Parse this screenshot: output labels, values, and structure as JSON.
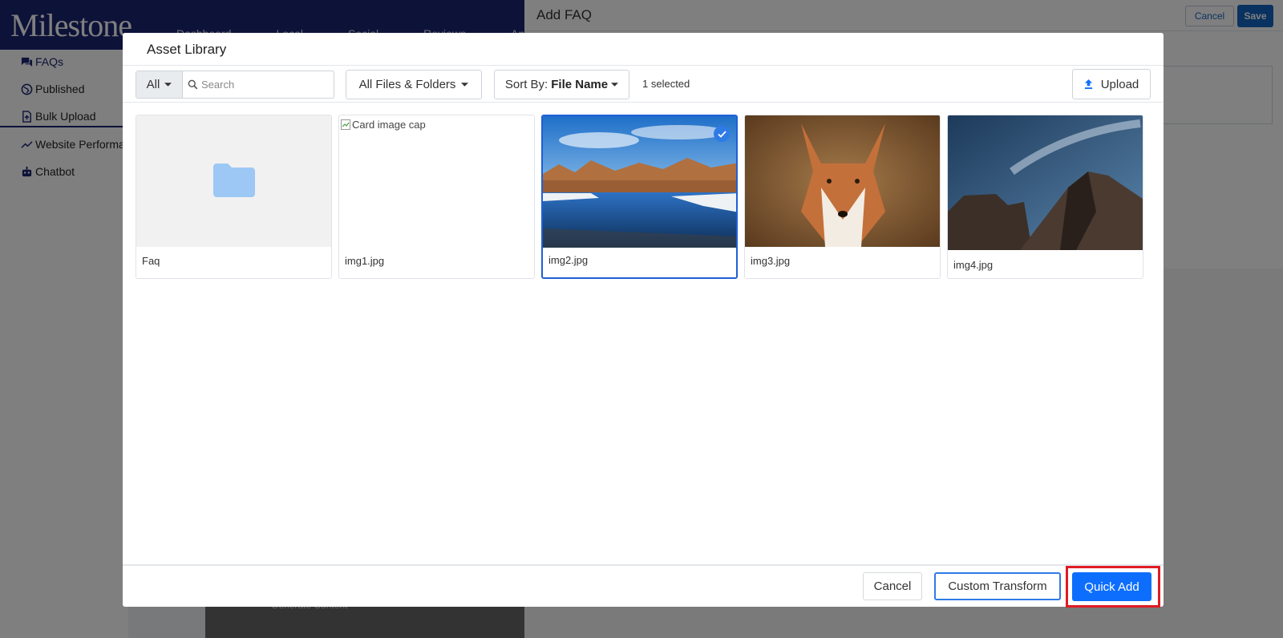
{
  "app": {
    "logo": "Milestone",
    "top_nav": [
      "Dashboard",
      "Local",
      "Social",
      "Reviews",
      "Analytics"
    ],
    "sidebar": [
      {
        "label": "FAQs",
        "icon": "chat-icon"
      },
      {
        "label": "Published",
        "icon": "globe-icon"
      },
      {
        "label": "Bulk Upload",
        "icon": "file-upload-icon"
      },
      {
        "label": "Website Performan",
        "icon": "trend-icon"
      },
      {
        "label": "Chatbot",
        "icon": "robot-icon"
      }
    ],
    "page_title": "Add FAQ",
    "header_cancel": "Cancel",
    "header_save": "Save",
    "bottom_text": "Generate Content"
  },
  "modal": {
    "title": "Asset Library",
    "filter_all": "All",
    "search_placeholder": "Search",
    "files_filter": "All Files & Folders",
    "sort_prefix": "Sort By:",
    "sort_value": "File Name",
    "selected_count": "1 selected",
    "upload_label": "Upload",
    "items": [
      {
        "name": "Faq",
        "type": "folder",
        "selected": false
      },
      {
        "name": "img1.jpg",
        "type": "broken-image",
        "alt": "Card image cap",
        "selected": false
      },
      {
        "name": "img2.jpg",
        "type": "image",
        "subject": "winter river landscape",
        "selected": true
      },
      {
        "name": "img3.jpg",
        "type": "image",
        "subject": "red fox portrait",
        "selected": false
      },
      {
        "name": "img4.jpg",
        "type": "image",
        "subject": "rock formations under sky",
        "selected": false
      }
    ],
    "footer": {
      "cancel": "Cancel",
      "custom_transform": "Custom Transform",
      "quick_add": "Quick Add"
    }
  },
  "colors": {
    "brand_navy": "#1b2473",
    "primary_blue": "#0d6efd",
    "selection_blue": "#1f5fd6",
    "highlight_red": "#e01b24"
  }
}
